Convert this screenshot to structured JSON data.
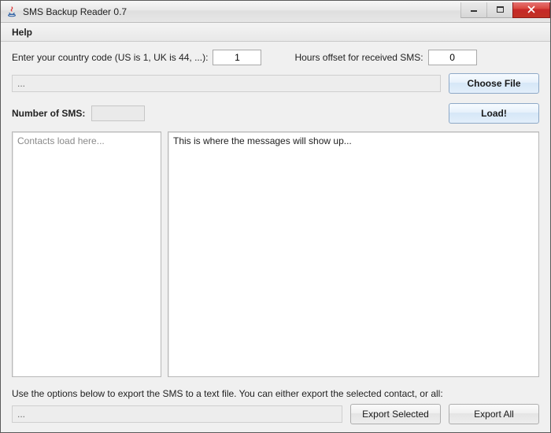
{
  "window": {
    "title": "SMS Backup Reader 0.7"
  },
  "menubar": {
    "help": "Help"
  },
  "inputs": {
    "country_label": "Enter your country code (US is 1, UK is 44, ...):",
    "country_value": "1",
    "offset_label": "Hours offset for received SMS:",
    "offset_value": "0"
  },
  "file": {
    "path_text": "...",
    "choose_label": "Choose File",
    "load_label": "Load!"
  },
  "sms": {
    "count_label": "Number of SMS:",
    "count_value": ""
  },
  "panels": {
    "contacts_placeholder": "Contacts load here...",
    "messages_placeholder": "This is where the messages will show up..."
  },
  "export": {
    "instruction": "Use the options below to export the SMS to a text file. You can either export the selected contact, or all:",
    "path_text": "...",
    "selected_label": "Export Selected",
    "all_label": "Export All"
  }
}
